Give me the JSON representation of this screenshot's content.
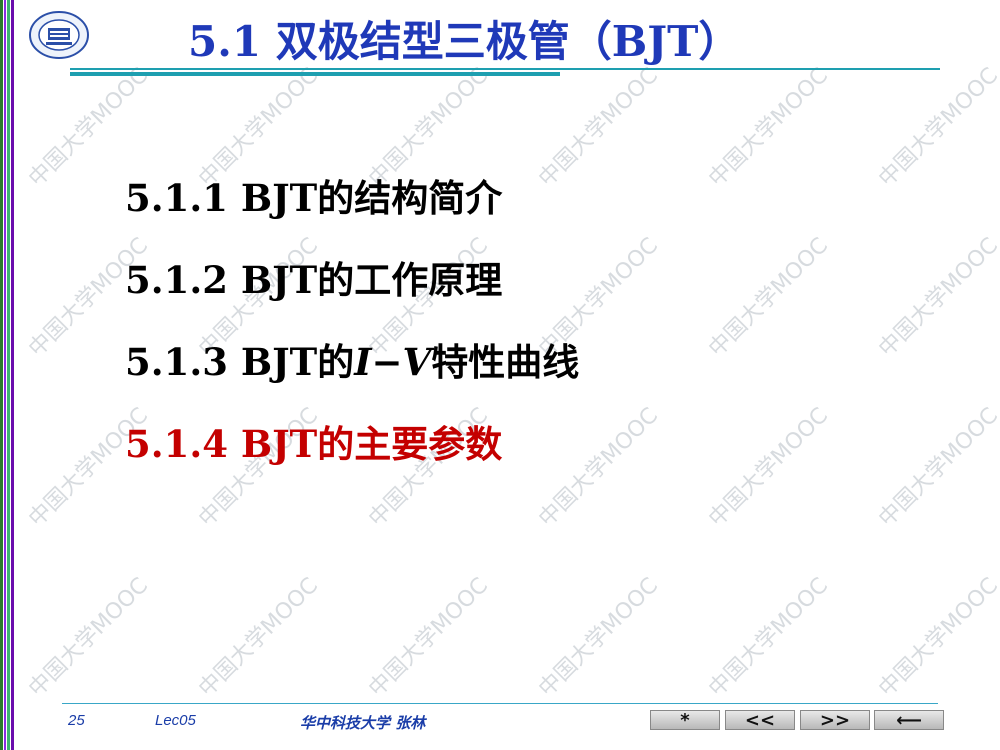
{
  "header": {
    "title": "5.1  双极结型三极管（BJT）",
    "logo_icon": "university-seal-logo"
  },
  "sections": [
    {
      "label": "5.1.1 BJT的结构简介",
      "active": false
    },
    {
      "label": "5.1.2 BJT的工作原理",
      "active": false
    },
    {
      "label": "5.1.3 BJT的I−V特性曲线",
      "active": false
    },
    {
      "label": "5.1.4 BJT的主要参数",
      "active": true
    }
  ],
  "footer": {
    "page": "25",
    "lecture": "Lec05",
    "author": "华中科技大学    张林"
  },
  "nav": [
    {
      "icon": "asterisk-icon",
      "glyph": "*"
    },
    {
      "icon": "double-left-icon",
      "glyph": "<<"
    },
    {
      "icon": "double-right-icon",
      "glyph": ">>"
    },
    {
      "icon": "return-icon",
      "glyph": "⟵"
    }
  ],
  "watermark": "中国大学MOOC",
  "colors": {
    "title": "#1f39b8",
    "active": "#c40000",
    "accent": "#1e9fb0"
  }
}
